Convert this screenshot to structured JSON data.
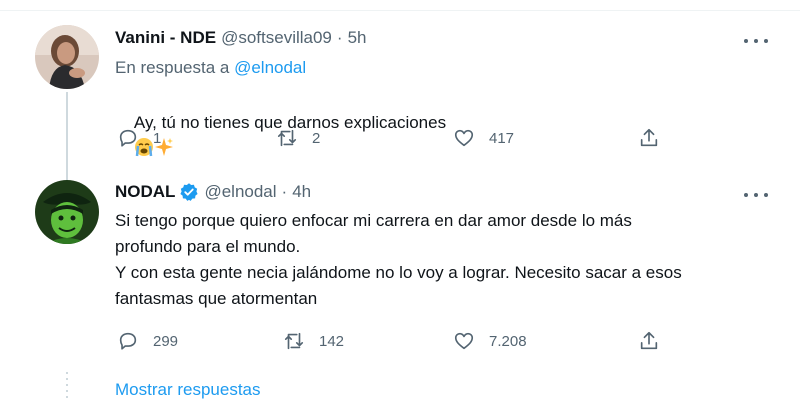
{
  "tweets": [
    {
      "name": "Vanini - NDE",
      "handle": "@softsevilla09",
      "time": "5h",
      "reply_prefix": "En respuesta a ",
      "reply_to": "@elnodal",
      "text": "Ay, tú no tienes que darnos explicaciones",
      "emoji_icons": [
        "crying-face-icon",
        "sparkles-icon"
      ],
      "replies": "1",
      "retweets": "2",
      "likes": "417",
      "verified": false
    },
    {
      "name": "NODAL",
      "handle": "@elnodal",
      "time": "4h",
      "text": "Si tengo porque quiero enfocar mi carrera en dar amor desde lo más\nprofundo para el mundo.\nY con esta gente necia jalándome no lo voy a lograr. Necesito sacar a esos\nfantasmas que atormentan",
      "replies": "299",
      "retweets": "142",
      "likes": "7.208",
      "verified": true
    }
  ],
  "separator": "·",
  "show_replies": "Mostrar respuestas",
  "colors": {
    "accent": "#1d9bf0",
    "muted": "#536471",
    "text": "#0f1419",
    "thread_line": "#cfd9de"
  }
}
